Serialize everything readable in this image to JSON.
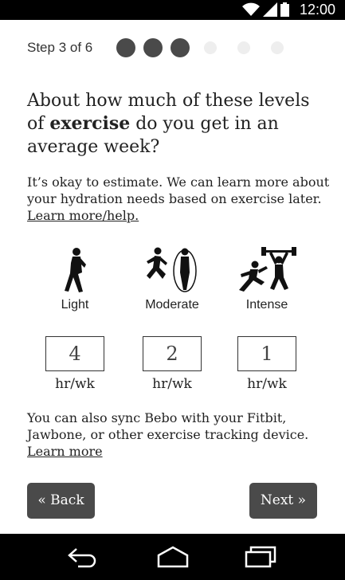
{
  "status_bar": {
    "time": "12:00"
  },
  "progress": {
    "label": "Step 3 of 6",
    "current_step": 3,
    "total_steps": 6
  },
  "question": {
    "before": "About how much of these levels of ",
    "emphasis": "exercise",
    "after": " do you get in an average week?"
  },
  "intro": {
    "text": "It’s okay to estimate. We can learn more about your hydration needs based on exercise later. ",
    "link": "Learn more/help."
  },
  "levels": [
    {
      "label": "Light",
      "icon": "walking-icon",
      "value": "4",
      "unit": "hr/wk"
    },
    {
      "label": "Moderate",
      "icon": "running-jump-rope-icon",
      "value": "2",
      "unit": "hr/wk"
    },
    {
      "label": "Intense",
      "icon": "sprint-weightlifting-icon",
      "value": "1",
      "unit": "hr/wk"
    }
  ],
  "sync": {
    "text": "You can also sync Bebo with your Fitbit, Jawbone, or other exercise tracking device. ",
    "link": "Learn more"
  },
  "buttons": {
    "back": "« Back",
    "next": "Next »"
  },
  "nav_bar": {
    "back_icon": "back-arrow-icon",
    "home_icon": "home-icon",
    "recents_icon": "recent-apps-icon"
  }
}
